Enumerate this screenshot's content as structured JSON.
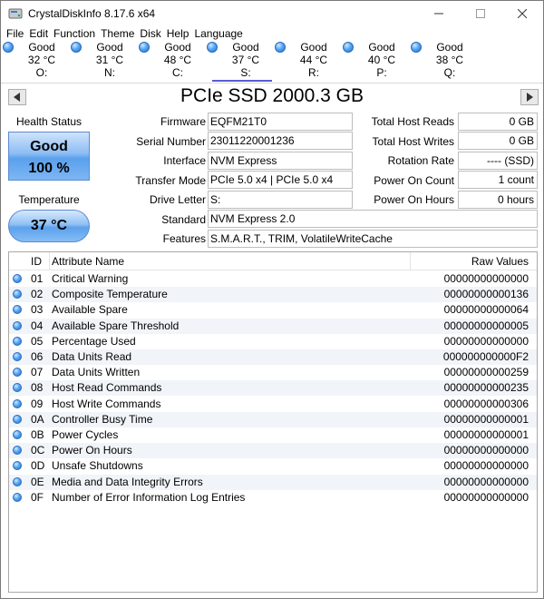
{
  "window": {
    "title": "CrystalDiskInfo 8.17.6 x64"
  },
  "menu": [
    "File",
    "Edit",
    "Function",
    "Theme",
    "Disk",
    "Help",
    "Language"
  ],
  "disks": [
    {
      "status": "Good",
      "temp": "32 °C",
      "letter": "O:"
    },
    {
      "status": "Good",
      "temp": "31 °C",
      "letter": "N:"
    },
    {
      "status": "Good",
      "temp": "48 °C",
      "letter": "C:"
    },
    {
      "status": "Good",
      "temp": "37 °C",
      "letter": "S:"
    },
    {
      "status": "Good",
      "temp": "44 °C",
      "letter": "R:"
    },
    {
      "status": "Good",
      "temp": "40 °C",
      "letter": "P:"
    },
    {
      "status": "Good",
      "temp": "38 °C",
      "letter": "Q:"
    }
  ],
  "model": {
    "title": "PCIe SSD 2000.3 GB"
  },
  "health": {
    "label": "Health Status",
    "status": "Good",
    "percent": "100 %"
  },
  "temperature": {
    "label": "Temperature",
    "value": "37 °C"
  },
  "info": {
    "firmware_label": "Firmware",
    "firmware": "EQFM21T0",
    "serial_label": "Serial Number",
    "serial": "23011220001236",
    "interface_label": "Interface",
    "interface": "NVM Express",
    "transfer_label": "Transfer Mode",
    "transfer": "PCIe 5.0 x4 | PCIe 5.0 x4",
    "letter_label": "Drive Letter",
    "letter": "S:",
    "standard_label": "Standard",
    "standard": "NVM Express 2.0",
    "features_label": "Features",
    "features": "S.M.A.R.T., TRIM, VolatileWriteCache",
    "reads_label": "Total Host Reads",
    "reads": "0 GB",
    "writes_label": "Total Host Writes",
    "writes": "0 GB",
    "rotation_label": "Rotation Rate",
    "rotation": "---- (SSD)",
    "poweron_count_label": "Power On Count",
    "poweron_count": "1 count",
    "poweron_hours_label": "Power On Hours",
    "poweron_hours": "0 hours"
  },
  "table": {
    "headers": {
      "id": "ID",
      "name": "Attribute Name",
      "raw": "Raw Values"
    },
    "rows": [
      {
        "id": "01",
        "name": "Critical Warning",
        "raw": "00000000000000"
      },
      {
        "id": "02",
        "name": "Composite Temperature",
        "raw": "00000000000136"
      },
      {
        "id": "03",
        "name": "Available Spare",
        "raw": "00000000000064"
      },
      {
        "id": "04",
        "name": "Available Spare Threshold",
        "raw": "00000000000005"
      },
      {
        "id": "05",
        "name": "Percentage Used",
        "raw": "00000000000000"
      },
      {
        "id": "06",
        "name": "Data Units Read",
        "raw": "000000000000F2"
      },
      {
        "id": "07",
        "name": "Data Units Written",
        "raw": "00000000000259"
      },
      {
        "id": "08",
        "name": "Host Read Commands",
        "raw": "00000000000235"
      },
      {
        "id": "09",
        "name": "Host Write Commands",
        "raw": "00000000000306"
      },
      {
        "id": "0A",
        "name": "Controller Busy Time",
        "raw": "00000000000001"
      },
      {
        "id": "0B",
        "name": "Power Cycles",
        "raw": "00000000000001"
      },
      {
        "id": "0C",
        "name": "Power On Hours",
        "raw": "00000000000000"
      },
      {
        "id": "0D",
        "name": "Unsafe Shutdowns",
        "raw": "00000000000000"
      },
      {
        "id": "0E",
        "name": "Media and Data Integrity Errors",
        "raw": "00000000000000"
      },
      {
        "id": "0F",
        "name": "Number of Error Information Log Entries",
        "raw": "00000000000000"
      }
    ]
  }
}
